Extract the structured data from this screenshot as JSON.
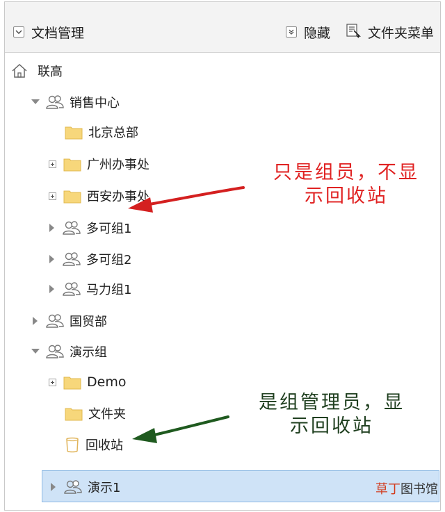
{
  "toolbar": {
    "title": "文档管理",
    "hide_label": "隐藏",
    "folder_menu_label": "文件夹菜单"
  },
  "tree": {
    "root": "联高",
    "sales": "销售中心",
    "beijing": "北京总部",
    "guangzhou": "广州办事处",
    "xian": "西安办事处",
    "duoke1": "多可组1",
    "duoke2": "多可组2",
    "mali1": "马力组1",
    "guomao": "国贸部",
    "demo_group": "演示组",
    "demo": "Demo",
    "folder": "文件夹",
    "recycle": "回收站",
    "demo1": "演示1"
  },
  "annotations": {
    "red_line1": "只是组员，不显",
    "red_line2": "示回收站",
    "green_line1": "是组管理员，显",
    "green_line2": "示回收站"
  },
  "watermark": {
    "part1": "草丁",
    "part2": "图书馆"
  },
  "colors": {
    "folder": "#f7d77b",
    "selection": "#cfe3f7",
    "red_note": "#e02222",
    "green_arrow": "#1f5a1f"
  }
}
